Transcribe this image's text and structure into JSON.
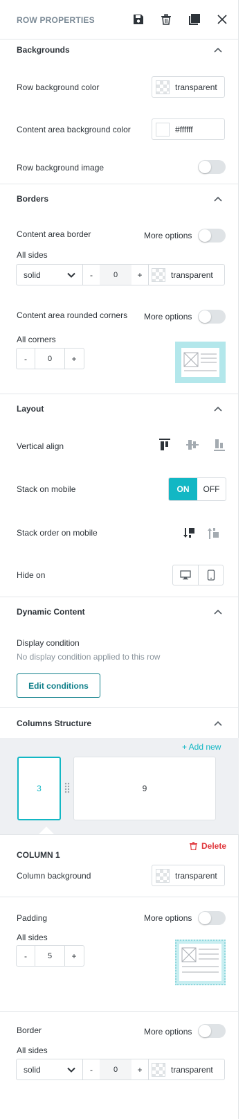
{
  "header": {
    "title": "ROW PROPERTIES"
  },
  "backgrounds": {
    "title": "Backgrounds",
    "row_bg_label": "Row background color",
    "row_bg_value": "transparent",
    "content_bg_label": "Content area background color",
    "content_bg_value": "#ffffff",
    "row_bg_image_label": "Row background image"
  },
  "borders": {
    "title": "Borders",
    "content_border_label": "Content area border",
    "more_options": "More options",
    "all_sides": "All sides",
    "style": "solid",
    "width": "0",
    "minus": "-",
    "plus": "+",
    "color": "transparent",
    "rounded_label": "Content area rounded corners",
    "all_corners": "All corners",
    "radius": "0"
  },
  "layout": {
    "title": "Layout",
    "vertical_align": "Vertical align",
    "stack_mobile": "Stack on mobile",
    "on": "ON",
    "off": "OFF",
    "stack_order": "Stack order on mobile",
    "hide_on": "Hide on"
  },
  "dynamic": {
    "title": "Dynamic Content",
    "display_condition": "Display condition",
    "no_condition": "No display condition applied to this row",
    "edit_button": "Edit conditions"
  },
  "columns": {
    "title": "Columns Structure",
    "add_new": "+ Add new",
    "col1": "3",
    "col2": "9",
    "column_name": "COLUMN 1",
    "delete": "Delete",
    "col_bg_label": "Column background",
    "col_bg_value": "transparent",
    "padding_label": "Padding",
    "more_options": "More options",
    "all_sides": "All sides",
    "padding_value": "5",
    "border_label": "Border",
    "border_more": "More options",
    "border_all_sides": "All sides",
    "border_style": "solid",
    "border_width": "0",
    "border_color": "transparent",
    "minus": "-",
    "plus": "+"
  },
  "colors": {
    "accent": "#12b7c4",
    "accent_dark": "#0f7f8a",
    "danger": "#e0393e",
    "icon_gray": "#2d3339"
  }
}
